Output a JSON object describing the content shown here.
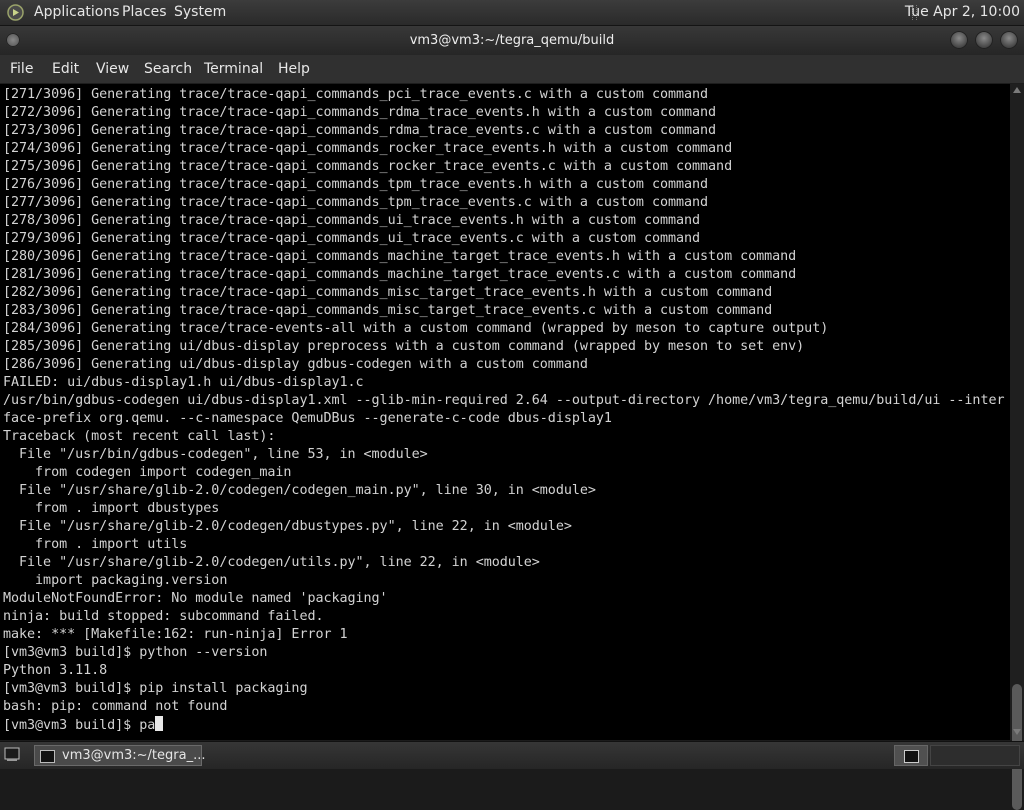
{
  "top_panel": {
    "menus": [
      "Applications",
      "Places",
      "System"
    ],
    "clock": "Tue Apr 2, 10:00"
  },
  "window": {
    "title": "vm3@vm3:~/tegra_qemu/build"
  },
  "menubar": {
    "items": [
      "File",
      "Edit",
      "View",
      "Search",
      "Terminal",
      "Help"
    ]
  },
  "terminal": {
    "lines": [
      "[271/3096] Generating trace/trace-qapi_commands_pci_trace_events.c with a custom command",
      "[272/3096] Generating trace/trace-qapi_commands_rdma_trace_events.h with a custom command",
      "[273/3096] Generating trace/trace-qapi_commands_rdma_trace_events.c with a custom command",
      "[274/3096] Generating trace/trace-qapi_commands_rocker_trace_events.h with a custom command",
      "[275/3096] Generating trace/trace-qapi_commands_rocker_trace_events.c with a custom command",
      "[276/3096] Generating trace/trace-qapi_commands_tpm_trace_events.h with a custom command",
      "[277/3096] Generating trace/trace-qapi_commands_tpm_trace_events.c with a custom command",
      "[278/3096] Generating trace/trace-qapi_commands_ui_trace_events.h with a custom command",
      "[279/3096] Generating trace/trace-qapi_commands_ui_trace_events.c with a custom command",
      "[280/3096] Generating trace/trace-qapi_commands_machine_target_trace_events.h with a custom command",
      "[281/3096] Generating trace/trace-qapi_commands_machine_target_trace_events.c with a custom command",
      "[282/3096] Generating trace/trace-qapi_commands_misc_target_trace_events.h with a custom command",
      "[283/3096] Generating trace/trace-qapi_commands_misc_target_trace_events.c with a custom command",
      "[284/3096] Generating trace/trace-events-all with a custom command (wrapped by meson to capture output)",
      "[285/3096] Generating ui/dbus-display preprocess with a custom command (wrapped by meson to set env)",
      "[286/3096] Generating ui/dbus-display gdbus-codegen with a custom command",
      "FAILED: ui/dbus-display1.h ui/dbus-display1.c",
      "/usr/bin/gdbus-codegen ui/dbus-display1.xml --glib-min-required 2.64 --output-directory /home/vm3/tegra_qemu/build/ui --inter",
      "face-prefix org.qemu. --c-namespace QemuDBus --generate-c-code dbus-display1",
      "Traceback (most recent call last):",
      "  File \"/usr/bin/gdbus-codegen\", line 53, in <module>",
      "    from codegen import codegen_main",
      "  File \"/usr/share/glib-2.0/codegen/codegen_main.py\", line 30, in <module>",
      "    from . import dbustypes",
      "  File \"/usr/share/glib-2.0/codegen/dbustypes.py\", line 22, in <module>",
      "    from . import utils",
      "  File \"/usr/share/glib-2.0/codegen/utils.py\", line 22, in <module>",
      "    import packaging.version",
      "ModuleNotFoundError: No module named 'packaging'",
      "ninja: build stopped: subcommand failed.",
      "make: *** [Makefile:162: run-ninja] Error 1",
      "[vm3@vm3 build]$ python --version",
      "Python 3.11.8",
      "[vm3@vm3 build]$ pip install packaging",
      "bash: pip: command not found"
    ],
    "current_prompt": "[vm3@vm3 build]$ pa"
  },
  "taskbar": {
    "task_label": "vm3@vm3:~/tegra_..."
  }
}
